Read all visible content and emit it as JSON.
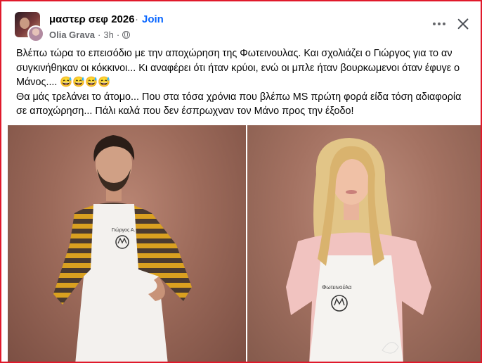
{
  "header": {
    "group_name": "μαστερ σεφ 2026",
    "separator": "·",
    "join_label": "Join",
    "author": "Olia Grava",
    "time": "3h",
    "meta_separator": "·"
  },
  "icons": {
    "privacy": "globe-icon",
    "more": "more-icon",
    "close": "close-icon"
  },
  "post": {
    "line1": "Βλέπω τώρα το επεισόδιο με την αποχώρηση της Φωτεινουλας. Και σχολιάζει ο Γιώργος για το αν συγκινήθηκαν οι κόκκινοι...  Κι αναφέρει ότι ήταν κρύοι, ενώ οι μπλε ήταν βουρκωμενοι όταν έφυγε ο Μάνος.... 😅😅😅😅",
    "line2": "Θα μάς τρελάνει το άτομο... Που στα τόσα χρόνια που βλέπω MS πρώτη φορά είδα τόση αδιαφορία σε αποχώρηση... Πάλι καλά που δεν έσπρωχναν τον Μάνο προς την έξοδο!"
  },
  "photos": {
    "left_apron_label": "Γιώργος Α.",
    "right_apron_label": "Φωτεινούλα"
  },
  "colors": {
    "join": "#0866ff",
    "border": "#e0192b",
    "secondary_text": "#65676b"
  }
}
